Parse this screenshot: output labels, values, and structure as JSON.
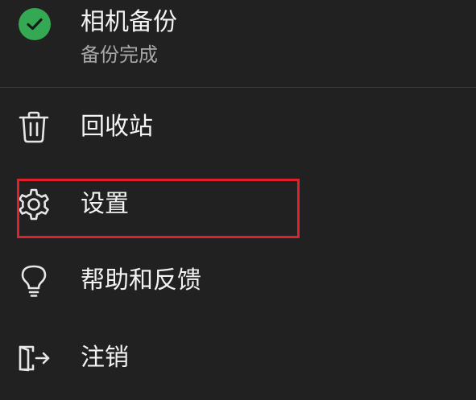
{
  "backup": {
    "title": "相机备份",
    "status": "备份完成",
    "icon": "check-circle-icon",
    "badge_color": "#34a853"
  },
  "menu": {
    "items": [
      {
        "label": "回收站",
        "icon": "trash-icon"
      },
      {
        "label": "设置",
        "icon": "gear-icon"
      },
      {
        "label": "帮助和反馈",
        "icon": "lightbulb-icon"
      },
      {
        "label": "注销",
        "icon": "sign-out-icon"
      }
    ]
  },
  "highlight": {
    "target": "设置",
    "color": "#e0202a"
  }
}
